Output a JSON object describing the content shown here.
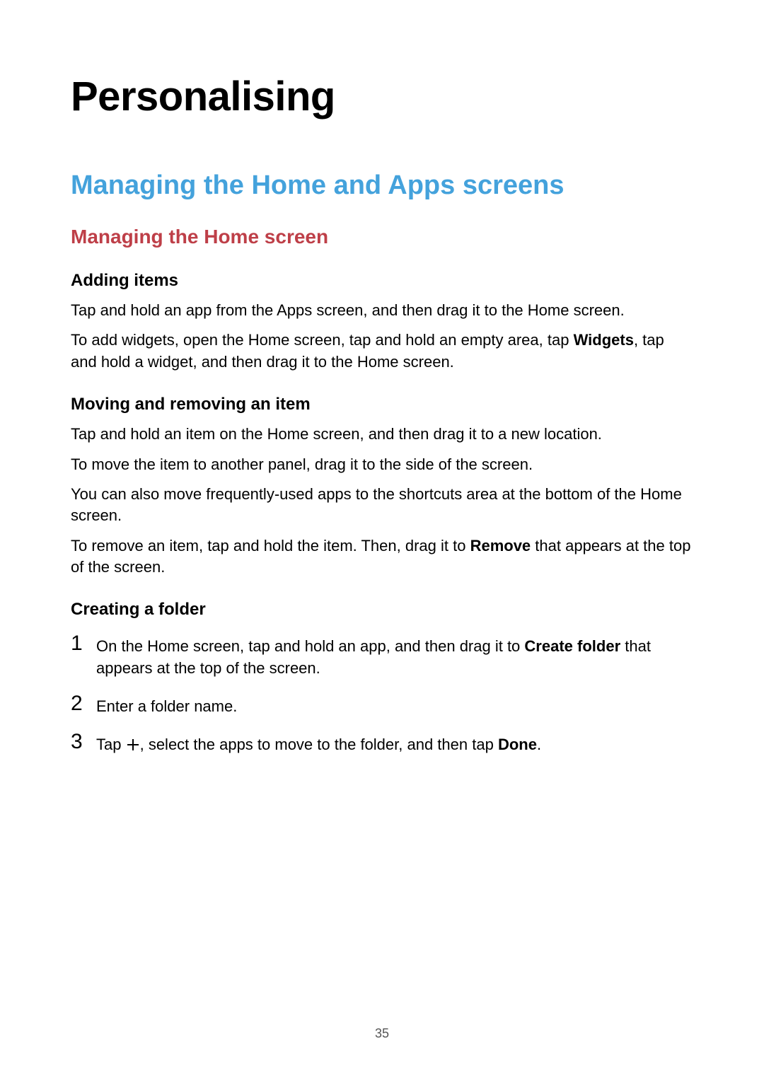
{
  "page": {
    "number": "35",
    "h1": "Personalising",
    "h2": "Managing the Home and Apps screens",
    "h3": "Managing the Home screen",
    "sections": {
      "adding": {
        "title": "Adding items",
        "p1": "Tap and hold an app from the Apps screen, and then drag it to the Home screen.",
        "p2a": "To add widgets, open the Home screen, tap and hold an empty area, tap ",
        "p2b_bold": "Widgets",
        "p2c": ", tap and hold a widget, and then drag it to the Home screen."
      },
      "moving": {
        "title": "Moving and removing an item",
        "p1": "Tap and hold an item on the Home screen, and then drag it to a new location.",
        "p2": "To move the item to another panel, drag it to the side of the screen.",
        "p3": "You can also move frequently-used apps to the shortcuts area at the bottom of the Home screen.",
        "p4a": "To remove an item, tap and hold the item. Then, drag it to ",
        "p4b_bold": "Remove",
        "p4c": " that appears at the top of the screen."
      },
      "folder": {
        "title": "Creating a folder",
        "steps": {
          "s1": {
            "num": "1",
            "a": "On the Home screen, tap and hold an app, and then drag it to ",
            "b_bold": "Create folder",
            "c": " that appears at the top of the screen."
          },
          "s2": {
            "num": "2",
            "text": "Enter a folder name."
          },
          "s3": {
            "num": "3",
            "a": "Tap ",
            "b": ", select the apps to move to the folder, and then tap ",
            "c_bold": "Done",
            "d": "."
          }
        }
      }
    }
  }
}
